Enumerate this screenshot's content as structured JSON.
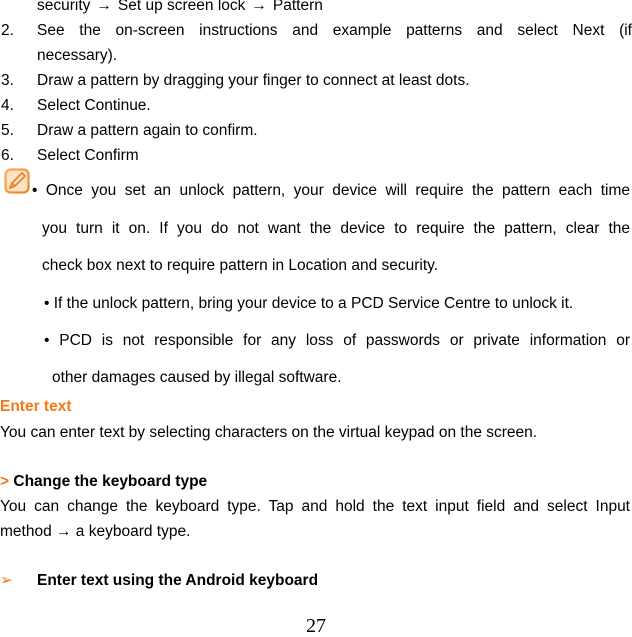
{
  "steps": {
    "intro_line": {
      "a": "security",
      "arrow1": "→",
      "b": "Set up screen lock",
      "arrow2": "→",
      "c": "Pattern"
    },
    "items": [
      {
        "num": "2.",
        "text": "See the on-screen instructions and example patterns and select Next (if",
        "cont": "necessary)."
      },
      {
        "num": "3.",
        "text": "Draw a pattern by dragging your finger to connect at least dots."
      },
      {
        "num": "4.",
        "text": "Select Continue."
      },
      {
        "num": "5.",
        "text": "Draw a pattern again to confirm."
      },
      {
        "num": "6.",
        "text": "Select Confirm"
      }
    ]
  },
  "note": {
    "icon": "note-pencil-icon",
    "bullet1_line1": "• Once you set an unlock pattern, your device will require the pattern each time",
    "bullet1_line2": "you turn it on. If you do not want the device to require the pattern, clear the",
    "bullet1_line3": "check box next to require pattern in Location and security.",
    "bullet2": "• If the unlock pattern, bring your device to a PCD Service Centre to unlock it.",
    "bullet3_line1": "• PCD is not responsible for any loss of passwords or private information or",
    "bullet3_line2": "other damages caused by illegal software."
  },
  "enter_text": {
    "heading": "Enter text",
    "body": "You can enter text by selecting characters on the virtual keypad on the screen."
  },
  "change_keyboard": {
    "marker": ">",
    "heading": "Change the keyboard type",
    "body_line1": "You can change the keyboard type. Tap and hold the text input field and select Input",
    "body_line2": "method → a keyboard type."
  },
  "android_keyboard": {
    "marker": "➢",
    "heading": "Enter text using the Android keyboard"
  },
  "page_number": "27",
  "colors": {
    "accent": "#f07a1a"
  }
}
